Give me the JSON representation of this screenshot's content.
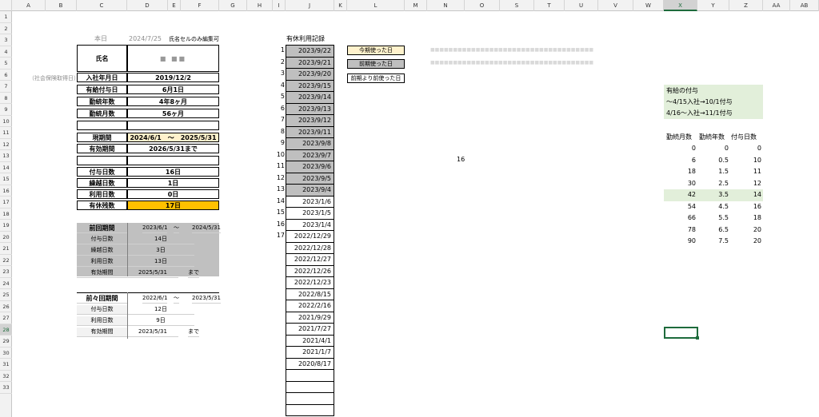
{
  "columns": [
    "A",
    "B",
    "C",
    "D",
    "E",
    "F",
    "G",
    "H",
    "I",
    "J",
    "K",
    "L",
    "M",
    "N",
    "O",
    "S",
    "T",
    "U",
    "V",
    "W",
    "X",
    "Y",
    "Z",
    "AA",
    "AB"
  ],
  "selected_column": "X",
  "rows": [
    "1",
    "2",
    "3",
    "4",
    "5",
    "6",
    "7",
    "8",
    "9",
    "10",
    "11",
    "12",
    "13",
    "14",
    "15",
    "16",
    "17",
    "18",
    "19",
    "20",
    "21",
    "22",
    "23",
    "24",
    "25",
    "26",
    "27",
    "28",
    "29",
    "30",
    "31",
    "32",
    "33"
  ],
  "selected_row": "28",
  "top": {
    "today_label": "本日",
    "today_value": "2024/7/25",
    "note": "氏名セルのみ編集可"
  },
  "side_note": "（社会保険取得日）",
  "info": [
    {
      "label": "氏名",
      "value": "■ ■■"
    },
    {
      "label": "入社年月日",
      "value": "2019/12/2"
    },
    {
      "label": "有給付与日",
      "value": "6月1日"
    },
    {
      "label": "勤続年数",
      "value": "4年8ヶ月"
    },
    {
      "label": "勤続月数",
      "value": "56ヶ月"
    },
    {
      "label": "",
      "value": ""
    },
    {
      "label": "現期間",
      "value": "2024/6/1　～　2025/5/31"
    },
    {
      "label": "有効期間",
      "value": "2026/5/31まで"
    },
    {
      "label": "",
      "value": ""
    },
    {
      "label": "付与日数",
      "value": "16日"
    },
    {
      "label": "繰越日数",
      "value": "1日"
    },
    {
      "label": "利用日数",
      "value": "0日"
    },
    {
      "label": "有休残数",
      "value": "17日"
    }
  ],
  "prev": {
    "title": "前回期間",
    "start": "2023/6/1",
    "tilde": "～",
    "end": "2024/5/31",
    "rows": [
      {
        "label": "付与日数",
        "value": "14日"
      },
      {
        "label": "繰越日数",
        "value": "3日"
      },
      {
        "label": "利用日数",
        "value": "13日"
      },
      {
        "label": "有効期間",
        "value": "2025/5/31",
        "suffix": "まで"
      }
    ]
  },
  "prev2": {
    "title": "前々回期間",
    "start": "2022/6/1",
    "tilde": "～",
    "end": "2023/5/31",
    "rows": [
      {
        "label": "付与日数",
        "value": "12日"
      },
      {
        "label": "利用日数",
        "value": "9日"
      },
      {
        "label": "有効期間",
        "value": "2023/5/31",
        "suffix": "まで"
      }
    ]
  },
  "vacation": {
    "title": "有休利用記録",
    "numbers": [
      "1",
      "2",
      "3",
      "4",
      "5",
      "6",
      "7",
      "8",
      "9",
      "10",
      "11",
      "12",
      "13",
      "14",
      "15",
      "16",
      "17"
    ],
    "dates": [
      "2023/9/22",
      "2023/9/21",
      "2023/9/20",
      "2023/9/15",
      "2023/9/14",
      "2023/9/13",
      "2023/9/12",
      "2023/9/11",
      "2023/9/8",
      "2023/9/7",
      "2023/9/6",
      "2023/9/5",
      "2023/9/4",
      "2023/1/6",
      "2023/1/5",
      "2023/1/4",
      "2022/12/29",
      "2022/12/28",
      "2022/12/27",
      "2022/12/26",
      "2022/12/23",
      "2022/8/15",
      "2022/2/16",
      "2021/9/29",
      "2021/7/27",
      "2021/4/1",
      "2021/1/7",
      "2020/8/17"
    ]
  },
  "legend": [
    "今期使った日",
    "前期使った日",
    "前期より前使った日"
  ],
  "faint_notes": [
    "■■■■■■■■■■■■■■■■■■■■■■■■■■■■■■■■■■■■",
    "■■■■■■■■■■■■■■■■■■■■■■■■■■■■■■■■■■■■"
  ],
  "cell_16": "16",
  "grant_info": {
    "title": "有給の付与",
    "line1": "～4/15入社→10/1付与",
    "line2": "4/16～入社→11/1付与"
  },
  "grant_table": {
    "headers": [
      "勤続月数",
      "勤続年数",
      "付与日数"
    ],
    "rows": [
      [
        "0",
        "0",
        "0"
      ],
      [
        "6",
        "0.5",
        "10"
      ],
      [
        "18",
        "1.5",
        "11"
      ],
      [
        "30",
        "2.5",
        "12"
      ],
      [
        "42",
        "3.5",
        "14"
      ],
      [
        "54",
        "4.5",
        "16"
      ],
      [
        "66",
        "5.5",
        "18"
      ],
      [
        "78",
        "6.5",
        "20"
      ],
      [
        "90",
        "7.5",
        "20"
      ]
    ],
    "highlight_row": 4
  },
  "colors": {
    "gray": "#bfbfbf",
    "yellow": "#fff2cc",
    "orange": "#ffc000",
    "green": "#e2efda",
    "excel_green": "#1e6b3c"
  }
}
